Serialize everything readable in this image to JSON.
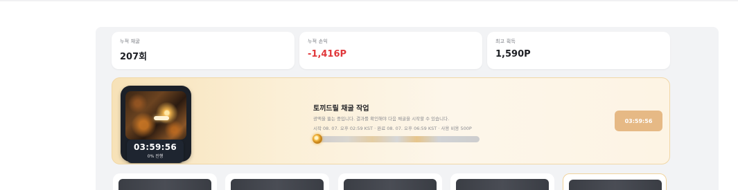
{
  "stats": [
    {
      "label": "누적 채굴",
      "value": "207회"
    },
    {
      "label": "누적 손익",
      "value": "-1,416P"
    },
    {
      "label": "최고 획득",
      "value": "1,590P"
    }
  ],
  "job": {
    "title": "토끼드릴 채굴 작업",
    "description": "광맥을 뚫는 중입니다. 결과를 확인해야 다음 채굴을 시작할 수 있습니다.",
    "meta": "시작 08. 07. 오후 02:59 KST · 완료 08. 07. 오후 06:59 KST · 사용 비용 500P",
    "timer": "03:59:56",
    "progress_text": "0% 진행",
    "progress": 0,
    "button_label": "03:59:56"
  },
  "colors": {
    "accent": "#e6b985",
    "negative": "#e0383b",
    "panel": "#f2f3f5"
  }
}
